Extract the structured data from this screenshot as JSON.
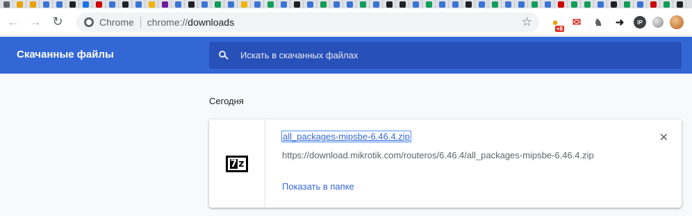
{
  "tabstrip": {
    "tab_colors": [
      "#5f6368",
      "#e8a200",
      "#e8a200",
      "#3a74d6",
      "#3a74d6",
      "#202124",
      "#1a73e8",
      "#cc0000",
      "#3a74d6",
      "#202124",
      "#3a74d6",
      "#f4b400",
      "#6a1b9a",
      "#3a74d6",
      "#202124",
      "#3a74d6",
      "#0f9d58",
      "#3a74d6",
      "#f4b400",
      "#3a74d6",
      "#0f9d58",
      "#3a74d6",
      "#202124",
      "#3a74d6",
      "#0f9d58",
      "#3a74d6",
      "#3a74d6",
      "#0f9d58",
      "#3a74d6",
      "#202124",
      "#202124",
      "#3a74d6",
      "#0f9d58",
      "#3a74d6",
      "#3a74d6",
      "#202124",
      "#3a74d6",
      "#0f9d58",
      "#3a74d6",
      "#3a74d6",
      "#0f9d58",
      "#3a74d6",
      "#cc0000",
      "#0f9d58",
      "#0f9d58",
      "#3a74d6",
      "#202124",
      "#0f9d58",
      "#3a74d6",
      "#cc0000",
      "#0f9d58",
      "#202124"
    ]
  },
  "toolbar": {
    "back_icon": "back-arrow-icon",
    "forward_icon": "forward-arrow-icon",
    "reload_icon": "reload-icon",
    "chip_label": "Chrome",
    "url_scheme": "chrome://",
    "url_path": "downloads",
    "star_icon": "bookmark-star-icon",
    "ext_badge": "+8"
  },
  "header": {
    "title": "Скачанные файлы",
    "search_placeholder": "Искать в скачанных файлах"
  },
  "downloads": {
    "section_label": "Сегодня",
    "items": [
      {
        "file_name": "all_packages-mipsbe-6.46.4.zip",
        "url": "https://download.mikrotik.com/routeros/6.46.4/all_packages-mipsbe-6.46.4.zip",
        "action_label": "Показать в папке"
      }
    ]
  },
  "colors": {
    "accent": "#3367d6",
    "search_bg": "#2850b9",
    "page_bg": "#f8f9fa"
  }
}
